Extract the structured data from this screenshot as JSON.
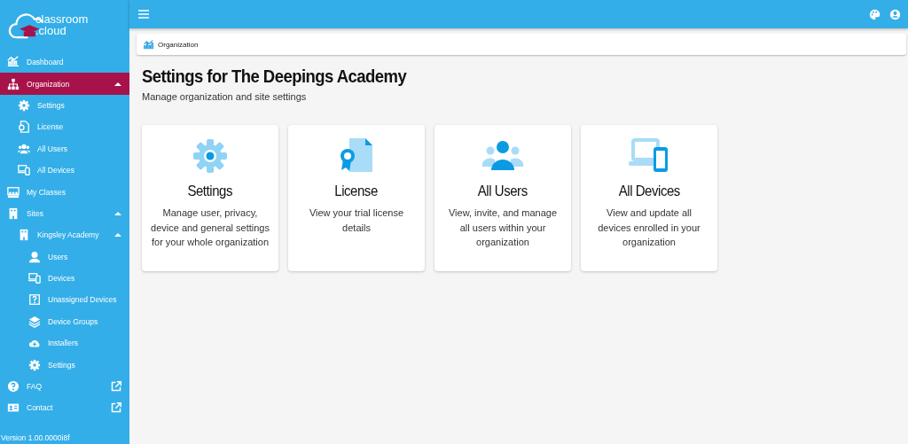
{
  "sidebar": {
    "logo": {
      "line_1": "classroom",
      "line_2": ".cloud"
    },
    "items": [
      {
        "label": "Dashboard",
        "selected": false
      },
      {
        "label": "Organization",
        "selected": true,
        "expanded": true,
        "children": [
          {
            "label": "Settings",
            "selected": false
          },
          {
            "label": "License",
            "selected": false
          },
          {
            "label": "All Users",
            "selected": false
          },
          {
            "label": "All Devices",
            "selected": false
          }
        ]
      },
      {
        "label": "My Classes",
        "selected": false
      },
      {
        "label": "Sites",
        "selected": false,
        "expanded": true,
        "children": [
          {
            "label": "Kingsley Academy",
            "selected": false,
            "expanded": true,
            "children": [
              {
                "label": "Users",
                "selected": false
              },
              {
                "label": "Devices",
                "selected": false
              },
              {
                "label": "Unassigned Devices",
                "selected": false
              },
              {
                "label": "Device Groups",
                "selected": false
              },
              {
                "label": "Installers",
                "selected": false
              },
              {
                "label": "Settings",
                "selected": false
              }
            ]
          }
        ]
      },
      {
        "label": "FAQ",
        "selected": false,
        "external": true
      },
      {
        "label": "Contact",
        "selected": false,
        "external": true
      }
    ],
    "version": "Version 1.00.0000i8f"
  },
  "breadcrumb": "Organization",
  "page": {
    "title": "Settings for The Deepings Academy",
    "subtitle": "Manage organization and site settings"
  },
  "cards": [
    {
      "title": "Settings",
      "description": "Manage user, privacy, device and general settings for your whole organization"
    },
    {
      "title": "License",
      "description": "View your trial license details"
    },
    {
      "title": "All Users",
      "description": "View, invite, and manage all users within your organization"
    },
    {
      "title": "All Devices",
      "description": "View and update all devices enrolled in your organization"
    }
  ]
}
